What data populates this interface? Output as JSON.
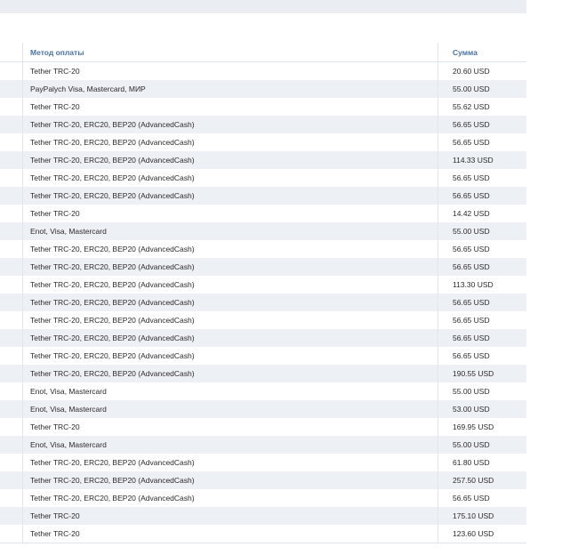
{
  "table": {
    "headers": {
      "method": "Метод оплаты",
      "sum": "Сумма"
    },
    "rows": [
      {
        "method": "Tether TRC-20",
        "sum": "20.60 USD"
      },
      {
        "method": "PayPalych Visa, Mastercard, МИР",
        "sum": "55.00 USD"
      },
      {
        "method": "Tether TRC-20",
        "sum": "55.62 USD"
      },
      {
        "method": "Tether TRC-20, ERC20, BEP20 (AdvancedCash)",
        "sum": "56.65 USD"
      },
      {
        "method": "Tether TRC-20, ERC20, BEP20 (AdvancedCash)",
        "sum": "56.65 USD"
      },
      {
        "method": "Tether TRC-20, ERC20, BEP20 (AdvancedCash)",
        "sum": "114.33 USD"
      },
      {
        "method": "Tether TRC-20, ERC20, BEP20 (AdvancedCash)",
        "sum": "56.65 USD"
      },
      {
        "method": "Tether TRC-20, ERC20, BEP20 (AdvancedCash)",
        "sum": "56.65 USD"
      },
      {
        "method": "Tether TRC-20",
        "sum": "14.42 USD"
      },
      {
        "method": "Enot, Visa, Mastercard",
        "sum": "55.00 USD"
      },
      {
        "method": "Tether TRC-20, ERC20, BEP20 (AdvancedCash)",
        "sum": "56.65 USD"
      },
      {
        "method": "Tether TRC-20, ERC20, BEP20 (AdvancedCash)",
        "sum": "56.65 USD"
      },
      {
        "method": "Tether TRC-20, ERC20, BEP20 (AdvancedCash)",
        "sum": "113.30 USD"
      },
      {
        "method": "Tether TRC-20, ERC20, BEP20 (AdvancedCash)",
        "sum": "56.65 USD"
      },
      {
        "method": "Tether TRC-20, ERC20, BEP20 (AdvancedCash)",
        "sum": "56.65 USD"
      },
      {
        "method": "Tether TRC-20, ERC20, BEP20 (AdvancedCash)",
        "sum": "56.65 USD"
      },
      {
        "method": "Tether TRC-20, ERC20, BEP20 (AdvancedCash)",
        "sum": "56.65 USD"
      },
      {
        "method": "Tether TRC-20, ERC20, BEP20 (AdvancedCash)",
        "sum": "190.55 USD"
      },
      {
        "method": "Enot, Visa, Mastercard",
        "sum": "55.00 USD"
      },
      {
        "method": "Enot, Visa, Mastercard",
        "sum": "53.00 USD"
      },
      {
        "method": "Tether TRC-20",
        "sum": "169.95 USD"
      },
      {
        "method": "Enot, Visa, Mastercard",
        "sum": "55.00 USD"
      },
      {
        "method": "Tether TRC-20, ERC20, BEP20 (AdvancedCash)",
        "sum": "61.80 USD"
      },
      {
        "method": "Tether TRC-20, ERC20, BEP20 (AdvancedCash)",
        "sum": "257.50 USD"
      },
      {
        "method": "Tether TRC-20, ERC20, BEP20 (AdvancedCash)",
        "sum": "56.65 USD"
      },
      {
        "method": "Tether TRC-20",
        "sum": "175.10 USD"
      },
      {
        "method": "Tether TRC-20",
        "sum": "123.60 USD"
      }
    ]
  },
  "colors": {
    "header_text": "#4a72a6",
    "stripe": "#edf1f6",
    "top_bar": "#eaeef3"
  }
}
